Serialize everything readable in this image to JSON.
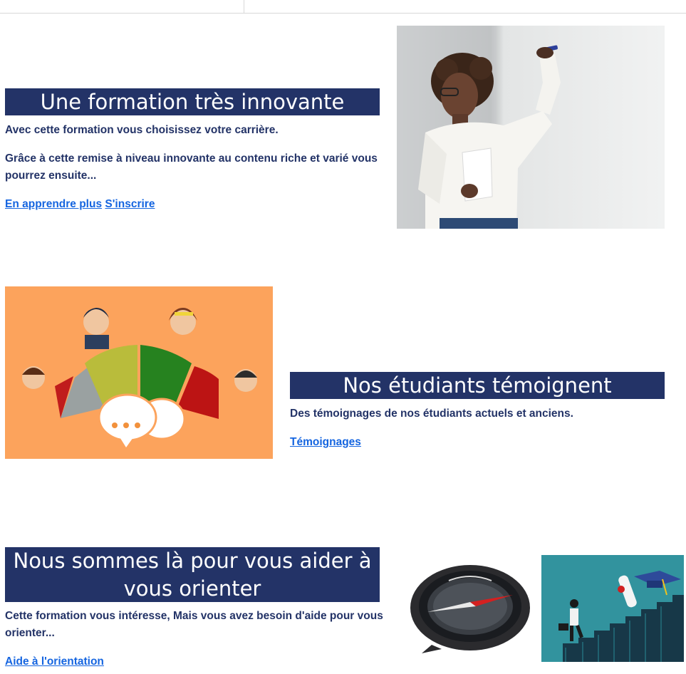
{
  "section1": {
    "title": "Une formation très innovante",
    "paragraph1": "Avec cette formation vous choisissez votre carrière.",
    "paragraph2": "Grâce à cette remise à niveau innovante au contenu riche et varié vous pourrez ensuite...",
    "link_learn_more": "En apprendre plus",
    "link_register": "S'inscrire",
    "image_icon": "teacher-photo"
  },
  "section2": {
    "title": "Nos étudiants témoignent",
    "paragraph": "Des témoignages de nos étudiants actuels et anciens.",
    "link_testimonials": "Témoignages",
    "image_icon": "students-discussion-illustration"
  },
  "section3": {
    "title": "Nous sommes là pour vous aider à vous orienter",
    "paragraph": "Cette formation vous intéresse, Mais vous avez besoin d'aide pour vous orienter...",
    "link_orientation": "Aide à l'orientation",
    "image_icons": [
      "compass-photo",
      "graduation-stairs-illustration"
    ]
  },
  "colors": {
    "banner": "#233367",
    "text": "#233367",
    "link": "#1565e0",
    "illustration_bg": "#fca35c"
  }
}
